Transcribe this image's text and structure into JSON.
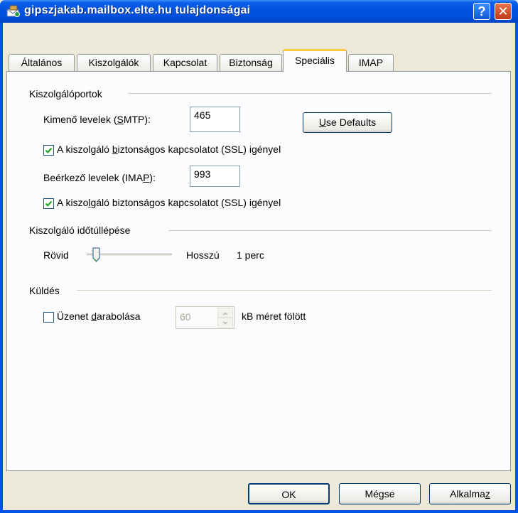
{
  "window": {
    "title": "gipszjakab.mailbox.elte.hu tulajdonságai",
    "help_glyph": "?",
    "close_glyph": "✕"
  },
  "tabs": [
    {
      "label": "Általános"
    },
    {
      "label": "Kiszolgálók"
    },
    {
      "label": "Kapcsolat"
    },
    {
      "label": "Biztonság"
    },
    {
      "label": "Speciális",
      "active": true
    },
    {
      "label": "IMAP"
    }
  ],
  "ports": {
    "group_label": "Kiszolgálóportok",
    "smtp_label_pre": "Kimenő levelek (",
    "smtp_label_u": "S",
    "smtp_label_post": "MTP):",
    "smtp_value": "465",
    "use_defaults_u": "U",
    "use_defaults_rest": "se Defaults",
    "smtp_ssl_pre": "A kiszolgáló ",
    "smtp_ssl_u": "b",
    "smtp_ssl_post": "iztonságos kapcsolatot (SSL) igényel",
    "smtp_ssl_checked": true,
    "imap_label_pre": "Beérkező levelek (IMA",
    "imap_label_u": "P",
    "imap_label_post": "):",
    "imap_value": "993",
    "imap_ssl_pre": "A kiszo",
    "imap_ssl_u": "l",
    "imap_ssl_post": "gáló biztonságos kapcsolatot (SSL) igényel",
    "imap_ssl_checked": true
  },
  "timeout": {
    "group_label": "Kiszolgáló időtúllépése",
    "short_label": "Rövid",
    "long_label": "Hosszú",
    "value_label": "1 perc",
    "slider_fraction": 0.07
  },
  "sending": {
    "group_label": "Küldés",
    "split_pre": "Üzenet ",
    "split_u": "d",
    "split_post": "arabolása",
    "split_checked": false,
    "split_value": "60",
    "split_unit": "kB méret fölött"
  },
  "buttons": {
    "ok": "OK",
    "cancel": "Mégse",
    "apply_pre": "Alkalma",
    "apply_u": "z"
  },
  "colors": {
    "titlebar": "#0054E3",
    "dialog_bg": "#ECE9D8",
    "tab_highlight": "#FFC83C",
    "check": "#21A121"
  }
}
